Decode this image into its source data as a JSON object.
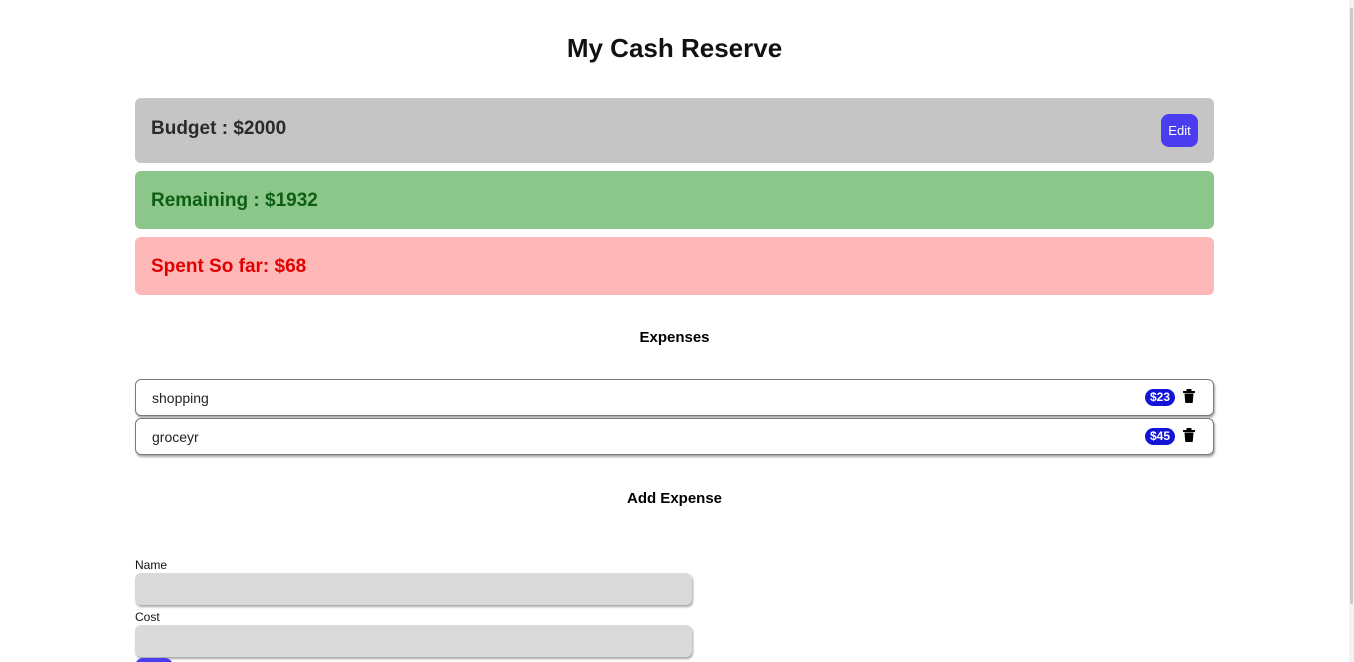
{
  "app": {
    "title": "My Cash Reserve"
  },
  "summary": {
    "budget_text": "Budget : $2000",
    "edit_label": "Edit",
    "remaining_text": "Remaining : $1932",
    "spent_text": "Spent So far: $68"
  },
  "expenses": {
    "heading": "Expenses",
    "items": [
      {
        "name": "shopping",
        "cost": "$23"
      },
      {
        "name": "groceyr",
        "cost": "$45"
      }
    ]
  },
  "add_expense": {
    "heading": "Add Expense",
    "name_label": "Name",
    "name_value": "",
    "cost_label": "Cost",
    "cost_value": ""
  },
  "icons": {
    "delete": "trash-icon"
  },
  "colors": {
    "budget_bg": "#c5c5c5",
    "remaining_bg": "#8bc78a",
    "remaining_text": "#0c5e12",
    "spent_bg": "#ffb8b8",
    "spent_text": "#e00000",
    "accent": "#4a3df0",
    "badge": "#1414d6"
  }
}
